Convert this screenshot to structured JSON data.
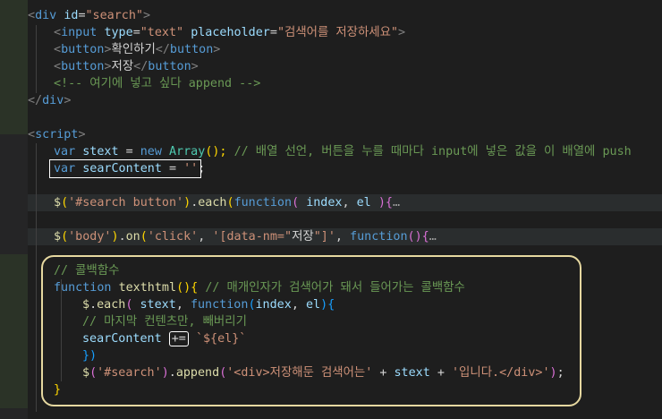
{
  "lines": {
    "l1": {
      "tag": "div",
      "attr": "id",
      "val": "\"search\""
    },
    "l2": {
      "tag": "input",
      "attr1": "type",
      "val1": "\"text\"",
      "attr2": "placeholder",
      "val2": "\"검색어를 저장하세요\""
    },
    "l3": {
      "tag": "button",
      "text": "확인하기"
    },
    "l4": {
      "tag": "button",
      "text": "저장"
    },
    "l5": {
      "comment": "<!-- 여기에 넣고 싶다 append -->"
    },
    "l6": {
      "tag": "div"
    },
    "l7": {
      "tag": "script"
    },
    "l8": {
      "kw": "var",
      "name": "stext",
      "op": "=",
      "new": "new",
      "type": "Array",
      "paren": "();",
      "comment": "// 배열 선언, 버튼을 누를 때마다 input에 넣은 값을 이 배열에 push"
    },
    "l9": {
      "kw": "var",
      "name": "searContent",
      "op": "=",
      "str": "''",
      "end": ";"
    },
    "l10": {
      "dollar": "$",
      "sel": "'#search button'",
      "each": "each",
      "fn": "function",
      "p1": "index",
      "p2": "el",
      "fold": "…"
    },
    "l11": {
      "dollar": "$",
      "sel": "'body'",
      "on": "on",
      "ev": "'click'",
      "sel2a": "'[data-nm=\"",
      "sel2b": "저장",
      "sel2c": "\"]'",
      "fn": "function",
      "fold": "…"
    },
    "l12": {
      "comment": "// 콜백함수"
    },
    "l13": {
      "kw": "function",
      "name": "texthtml",
      "comment": "// 매개인자가 검색어가 돼서 들어가는 콜백함수"
    },
    "l14": {
      "dollar": "$",
      "each": "each",
      "p0": "stext",
      "fn": "function",
      "p1": "index",
      "p2": "el"
    },
    "l15": {
      "comment": "// 마지막 컨텐츠만, 빼버리기"
    },
    "l16": {
      "name": "searContent",
      "op": "+=",
      "tpl": "`${el}`"
    },
    "l17": {
      "close": "})"
    },
    "l18": {
      "dollar": "$",
      "sel": "'#search'",
      "append": "append",
      "s1": "'<div>저장해둔 검색어는'",
      "plus": "+",
      "var": "stext",
      "s2": "'입니다.</div>'",
      "end": ";"
    },
    "l19": {
      "close": "}"
    }
  }
}
